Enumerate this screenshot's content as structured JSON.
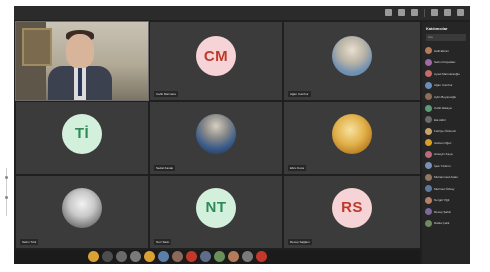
{
  "panel": {
    "title": "Katılımcılar",
    "search_placeholder": "Ara",
    "participants": [
      {
        "name": "Halil Ekinci",
        "color": "#b27c5c"
      },
      {
        "name": "Selim Kılıçaslan",
        "color": "#a06aa8"
      },
      {
        "name": "Aysel Marmaraoğlu",
        "color": "#c66a6a"
      },
      {
        "name": "Ağan Cumhur",
        "color": "#6a8fb8"
      },
      {
        "name": "Aylin Boyacıoğlu",
        "color": "#8d6f58"
      },
      {
        "name": "Cahit Akkaya",
        "color": "#5c9a7a"
      },
      {
        "name": "Ela Akbil",
        "color": "#6a6a6a"
      },
      {
        "name": "Fethiye Özdemir",
        "color": "#c8a46a"
      },
      {
        "name": "Gülcan Oğuz",
        "color": "#d6a12b"
      },
      {
        "name": "Hüseyin Kaya",
        "color": "#b96a7c"
      },
      {
        "name": "İpek Yıldırım",
        "color": "#7a8fb6"
      },
      {
        "name": "Muhammed Aslan",
        "color": "#8e7a64"
      },
      {
        "name": "Mehmet Özbay",
        "color": "#5e7a9a"
      },
      {
        "name": "Nurgül Yiğit",
        "color": "#b5806a"
      },
      {
        "name": "Recep Şahin",
        "color": "#7c6a9c"
      },
      {
        "name": "Rabia Çelik",
        "color": "#6d8a62"
      }
    ]
  },
  "tiles": [
    {
      "type": "video",
      "name": "Halil Ekinci"
    },
    {
      "type": "initials",
      "initials": "CM",
      "bg": "#f6d3d6",
      "fg": "#c0392b",
      "name": "Cahit Marmara"
    },
    {
      "type": "photo",
      "name": "Ağan Cumhur",
      "tone": "#6f8fb3"
    },
    {
      "type": "initials",
      "initials": "Tİ",
      "bg": "#d3f0dd",
      "fg": "#2e8b57",
      "name": "Tülin İnce"
    },
    {
      "type": "photo",
      "name": "Sedat Kavak",
      "tone": "#3b5c8a"
    },
    {
      "type": "photo",
      "name": "Ebru Koca",
      "tone": "#d9a233"
    },
    {
      "type": "photo",
      "name": "Selim Türk",
      "tone": "#7a7a7a"
    },
    {
      "type": "initials",
      "initials": "NT",
      "bg": "#d3f0dd",
      "fg": "#2e8b57",
      "name": "Nuri Tekin"
    },
    {
      "type": "initials",
      "initials": "RS",
      "bg": "#f6d3d6",
      "fg": "#c0392b",
      "name": "Recep Sağlam"
    }
  ],
  "toolbar": {
    "buttons": [
      {
        "icon": "emoji-icon",
        "color": "#d9a233"
      },
      {
        "icon": "mic-icon",
        "color": "#4d4d4d"
      },
      {
        "icon": "camera-icon",
        "color": "#6a6a6a"
      },
      {
        "icon": "share-screen-icon",
        "color": "#7a7a7a"
      },
      {
        "icon": "hand-icon",
        "color": "#d9a233"
      },
      {
        "icon": "chat-icon",
        "color": "#5c7faa"
      },
      {
        "icon": "more-icon",
        "color": "#8a6a5a"
      },
      {
        "icon": "record-icon",
        "color": "#c0392b"
      },
      {
        "icon": "breakout-icon",
        "color": "#5e6e8a"
      },
      {
        "icon": "apps-icon",
        "color": "#6a8f5a"
      },
      {
        "icon": "notes-icon",
        "color": "#b27c5c"
      },
      {
        "icon": "settings-icon",
        "color": "#7a7a7a"
      },
      {
        "icon": "leave-icon",
        "color": "#c0392b"
      }
    ]
  }
}
